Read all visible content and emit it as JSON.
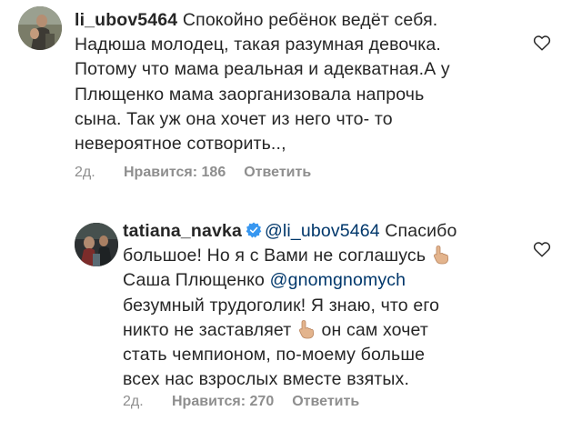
{
  "comments": [
    {
      "username": "li_ubov5464",
      "lines": [
        "Спокойно ребёнок ведёт себя.",
        "Надюша молодец, такая разумная девочка.",
        "Потому что мама реальная и адекватная.А у",
        "Плющенко мама заорганизовала напрочь",
        "сына. Так уж она хочет из него что- то",
        "невероятное сотворить..,"
      ],
      "time": "2д.",
      "likes": "Нравится: 186",
      "reply": "Ответить",
      "avatar_icon": "user-avatar-photo",
      "like_icon": "heart-outline-icon"
    },
    {
      "username": "tatiana_navka",
      "verified": true,
      "verified_icon": "verified-badge-icon",
      "mention_1": "@li_ubov5464",
      "text_1a": "Спасибо",
      "text_2": "большое! Но я с Вами не соглашусь",
      "text_3": "Саша Плющенко",
      "mention_2": "@gnomgnomych",
      "text_4": "безумный трудоголик! Я знаю, что его",
      "text_5": "никто не заставляет",
      "text_5b": "он сам хочет",
      "text_6": "стать чемпионом, по-моему больше",
      "text_7": "всех нас взрослых вместе взятых.",
      "emoji_icon": "pointing-up-hand-emoji-icon",
      "time": "2д.",
      "likes": "Нравится: 270",
      "reply": "Ответить",
      "avatar_icon": "user-avatar-photo",
      "like_icon": "heart-outline-icon"
    }
  ],
  "colors": {
    "text": "#262626",
    "meta": "#8e8e8e",
    "mention": "#00376b",
    "verified": "#3897f0"
  }
}
